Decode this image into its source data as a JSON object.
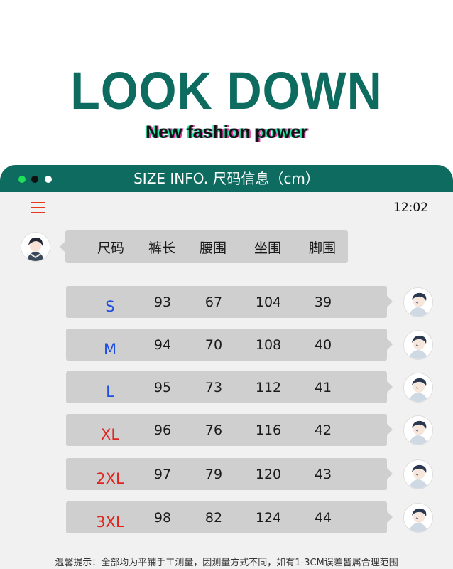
{
  "header": {
    "brand": "LOOK DOWN",
    "tagline": "New fashion power"
  },
  "panel": {
    "title": "SIZE INFO. 尺码信息（cm）",
    "time": "12:02"
  },
  "table": {
    "columns": [
      "尺码",
      "裤长",
      "腰围",
      "坐围",
      "脚围"
    ],
    "rows": [
      {
        "size": "S",
        "size_color": "#1f4fe0",
        "values": [
          "93",
          "67",
          "104",
          "39"
        ]
      },
      {
        "size": "M",
        "size_color": "#1f4fe0",
        "values": [
          "94",
          "70",
          "108",
          "40"
        ]
      },
      {
        "size": "L",
        "size_color": "#1f4fe0",
        "values": [
          "95",
          "73",
          "112",
          "41"
        ]
      },
      {
        "size": "XL",
        "size_color": "#e0231e",
        "values": [
          "96",
          "76",
          "116",
          "42"
        ]
      },
      {
        "size": "2XL",
        "size_color": "#e0231e",
        "values": [
          "97",
          "79",
          "120",
          "43"
        ]
      },
      {
        "size": "3XL",
        "size_color": "#e0231e",
        "values": [
          "98",
          "82",
          "124",
          "44"
        ]
      }
    ]
  },
  "note": "温馨提示：全部均为平铺手工测量，因测量方式不同，如有1-3CM误差皆属合理范围",
  "colors": {
    "brand": "#0e6b5f",
    "menu_icon": "#e53a1e",
    "bubble": "#cfcfcf"
  }
}
